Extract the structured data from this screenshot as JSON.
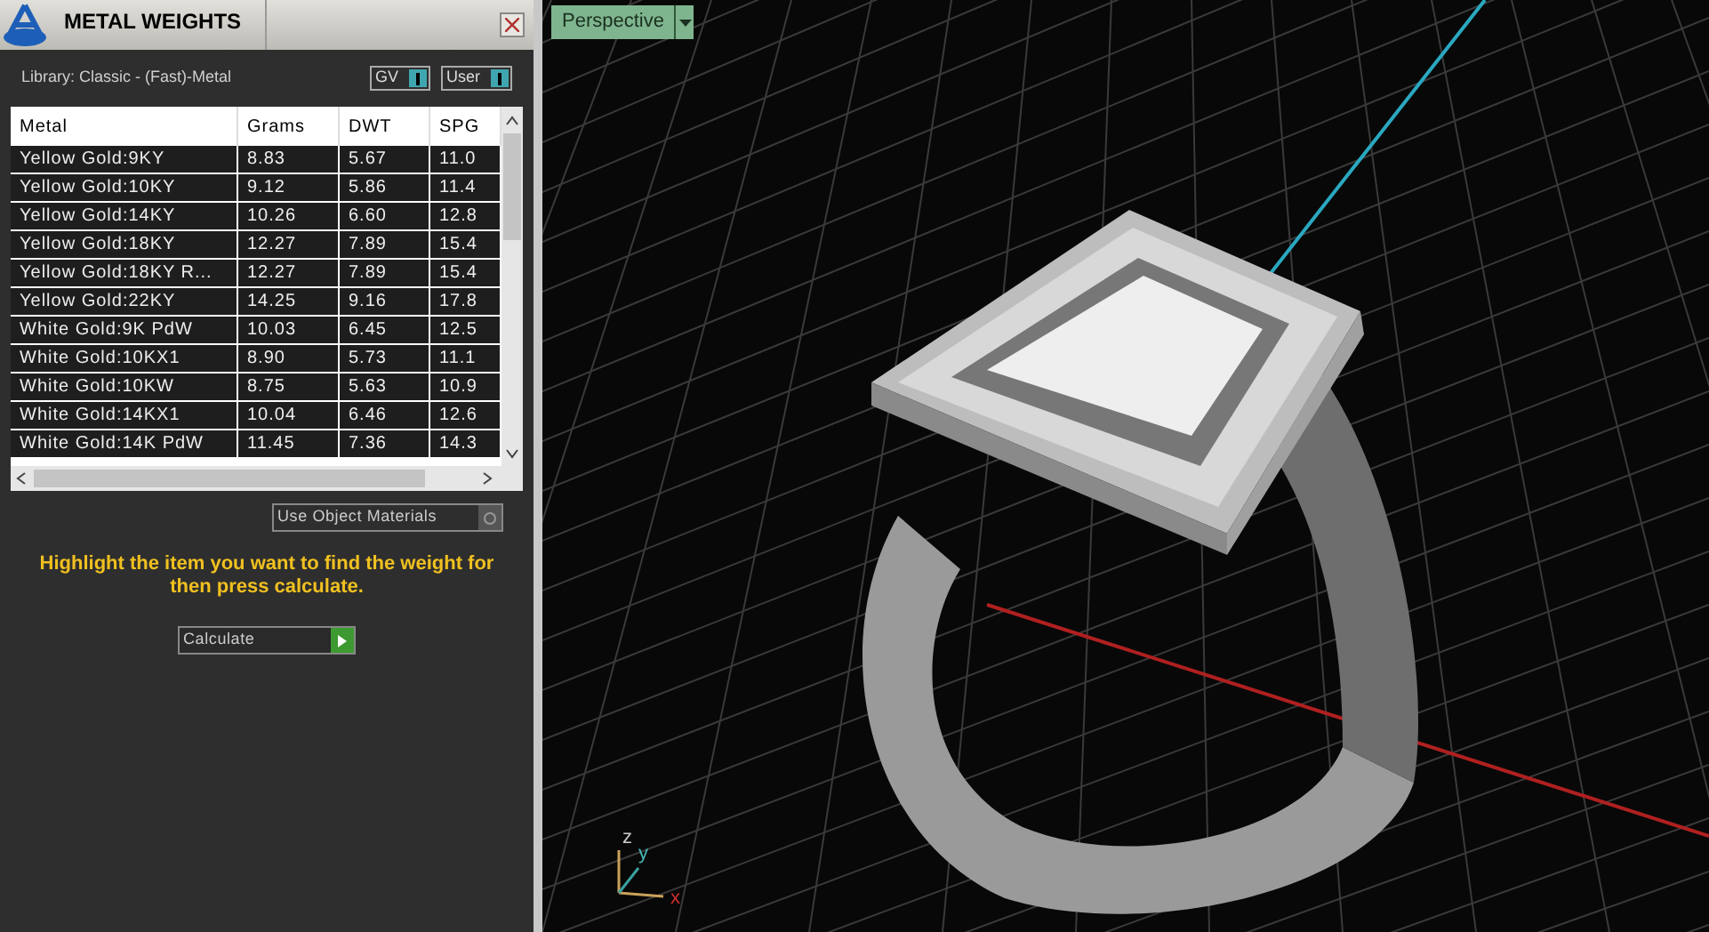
{
  "panel": {
    "title": "METAL WEIGHTS",
    "library": "Library: Classic - (Fast)-Metal",
    "toggles": [
      {
        "label": "GV",
        "on": true
      },
      {
        "label": "User",
        "on": true
      }
    ]
  },
  "table": {
    "columns": [
      "Metal",
      "Grams",
      "DWT",
      "SPG"
    ],
    "rows": [
      {
        "cells": [
          "Yellow Gold:9KY",
          "8.83",
          "5.67",
          "11.0"
        ],
        "selected": false
      },
      {
        "cells": [
          "Yellow Gold:10KY",
          "9.12",
          "5.86",
          "11.4"
        ],
        "selected": false
      },
      {
        "cells": [
          "Yellow Gold:14KY",
          "10.26",
          "6.60",
          "12.8"
        ],
        "selected": false
      },
      {
        "cells": [
          "Yellow Gold:18KY",
          "12.27",
          "7.89",
          "15.4"
        ],
        "selected": false
      },
      {
        "cells": [
          "Yellow Gold:18KY R...",
          "12.27",
          "7.89",
          "15.4"
        ],
        "selected": false
      },
      {
        "cells": [
          "Yellow Gold:22KY",
          "14.25",
          "9.16",
          "17.8"
        ],
        "selected": false
      },
      {
        "cells": [
          "White Gold:9K PdW",
          "10.03",
          "6.45",
          "12.5"
        ],
        "selected": false
      },
      {
        "cells": [
          "White Gold:10KX1",
          "8.90",
          "5.73",
          "11.1"
        ],
        "selected": false
      },
      {
        "cells": [
          "White Gold:10KW",
          "8.75",
          "5.63",
          "10.9"
        ],
        "selected": false
      },
      {
        "cells": [
          "White Gold:14KX1",
          "10.04",
          "6.46",
          "12.6"
        ],
        "selected": false
      },
      {
        "cells": [
          "White Gold:14K PdW",
          "11.45",
          "7.36",
          "14.3"
        ],
        "selected": false
      }
    ]
  },
  "use_object_materials": {
    "label": "Use Object Materials"
  },
  "message": "Highlight the item you want to find the weight for then press calculate.",
  "calculate_button": "Calculate",
  "viewport": {
    "tab": "Perspective",
    "axes": [
      "z",
      "y",
      "x"
    ]
  }
}
